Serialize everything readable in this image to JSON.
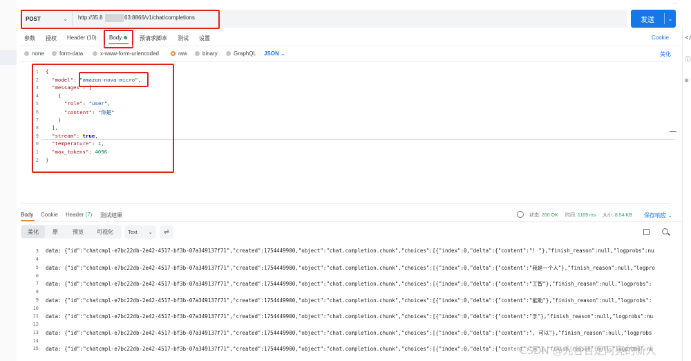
{
  "request": {
    "method": "POST",
    "url_prefix": "http://35.8",
    "url_suffix": "63:8866/v1/chat/completions",
    "send_label": "发送"
  },
  "request_tabs": [
    {
      "label": "参数"
    },
    {
      "label": "授权"
    },
    {
      "label": "Header (10)"
    },
    {
      "label": "Body"
    },
    {
      "label": "预请求脚本"
    },
    {
      "label": "测试"
    },
    {
      "label": "设置"
    }
  ],
  "cookie_label": "Cookie",
  "body_types": [
    {
      "label": "none"
    },
    {
      "label": "form-data"
    },
    {
      "label": "x-www-form-urlencoded"
    },
    {
      "label": "raw"
    },
    {
      "label": "binary"
    },
    {
      "label": "GraphQL"
    }
  ],
  "body_format": "JSON",
  "beautify_label": "美化",
  "editor": {
    "line_numbers": [
      "1",
      "2",
      "3",
      "4",
      "5",
      "6",
      "7",
      "8",
      "9",
      "0",
      "1",
      "2"
    ],
    "lines": [
      {
        "a": "{"
      },
      {
        "k": "\"model\"",
        "p": ": ",
        "s": "\"amazon-nova-micro\"",
        "e": ","
      },
      {
        "k": "\"messages\"",
        "p": ": ["
      },
      {
        "a": "{"
      },
      {
        "k": "\"role\"",
        "p": ": ",
        "s": "\"user\"",
        "e": ","
      },
      {
        "k": "\"content\"",
        "p": ": ",
        "s": "\"你是\""
      },
      {
        "a": "}"
      },
      {
        "a": "],"
      },
      {
        "k": "\"stream\"",
        "p": ": ",
        "kw": "true",
        "e": ","
      },
      {
        "k": "\"temperature\"",
        "p": ": ",
        "n": "1",
        "e": ","
      },
      {
        "k": "\"max_tokens\"",
        "p": ": ",
        "n": "4096"
      },
      {
        "a": "}"
      }
    ]
  },
  "response_tabs": [
    {
      "label": "Body"
    },
    {
      "label": "Cookie"
    },
    {
      "label": "Header"
    },
    {
      "label": "(7)"
    },
    {
      "label": "测试结果"
    }
  ],
  "status": {
    "status_label": "状态:",
    "status_value": "200 OK",
    "time_label": "时间:",
    "time_value": "1169 ms",
    "size_label": "大小:",
    "size_value": "8.54 KB"
  },
  "save_response_label": "保存响应",
  "view_modes": [
    {
      "label": "美化"
    },
    {
      "label": "原"
    },
    {
      "label": "预览"
    },
    {
      "label": "可视化"
    }
  ],
  "text_format": "Text",
  "response_lines": [
    {
      "n": "3",
      "t": "data: {\"id\":\"chatcmpl-e7bc22db-2e42-4517-bf3b-07a349137f71\",\"created\":1754449900,\"object\":\"chat.completion.chunk\",\"choices\":[{\"index\":0,\"delta\":{\"content\":\"! \"},\"finish_reason\":null,\"logprobs\":nu"
    },
    {
      "n": "5",
      "t": "data: {\"id\":\"chatcmpl-e7bc22db-2e42-4517-bf3b-07a349137f71\",\"created\":1754449900,\"object\":\"chat.completion.chunk\",\"choices\":[{\"index\":0,\"delta\":{\"content\":\"我是一个人\"},\"finish_reason\":null,\"logpro"
    },
    {
      "n": "7",
      "t": "data: {\"id\":\"chatcmpl-e7bc22db-2e42-4517-bf3b-07a349137f71\",\"created\":1754449900,\"object\":\"chat.completion.chunk\",\"choices\":[{\"index\":0,\"delta\":{\"content\":\"工智\"},\"finish_reason\":null,\"logprobs\":"
    },
    {
      "n": "9",
      "t": "data: {\"id\":\"chatcmpl-e7bc22db-2e42-4517-bf3b-07a349137f71\",\"created\":1754449900,\"object\":\"chat.completion.chunk\",\"choices\":[{\"index\":0,\"delta\":{\"content\":\"能助\"},\"finish_reason\":null,\"logprobs\":"
    },
    {
      "n": "11",
      "t": "data: {\"id\":\"chatcmpl-e7bc22db-2e42-4517-bf3b-07a349137f71\",\"created\":1754449900,\"object\":\"chat.completion.chunk\",\"choices\":[{\"index\":0,\"delta\":{\"content\":\"手\"},\"finish_reason\":null,\"logprobs\":nu"
    },
    {
      "n": "13",
      "t": "data: {\"id\":\"chatcmpl-e7bc22db-2e42-4517-bf3b-07a349137f71\",\"created\":1754449900,\"object\":\"chat.completion.chunk\",\"choices\":[{\"index\":0,\"delta\":{\"content\":\", 可以\"},\"finish_reason\":null,\"logprobs"
    },
    {
      "n": "15",
      "t": "data: {\"id\":\"chatcmpl-e7bc22db-2e42-4517-bf3b-07a349137f71\",\"created\":1754449900,\"object\":\"chat.completion.chunk\",\"choices\":[{\"index\":0,\"delta\":{\"content\":\"回\"},\"finish_reason\":null,\"logprobs\":nu"
    }
  ],
  "response_gap_numbers": [
    "4",
    "6",
    "8",
    "10",
    "12",
    "14"
  ],
  "watermark": "CSDN @光谷百定阿亮的新人",
  "colors": {
    "accent_blue": "#1677e6",
    "highlight_red": "#e0201c",
    "tab_orange": "#f5862b",
    "status_green": "#23a55a"
  }
}
